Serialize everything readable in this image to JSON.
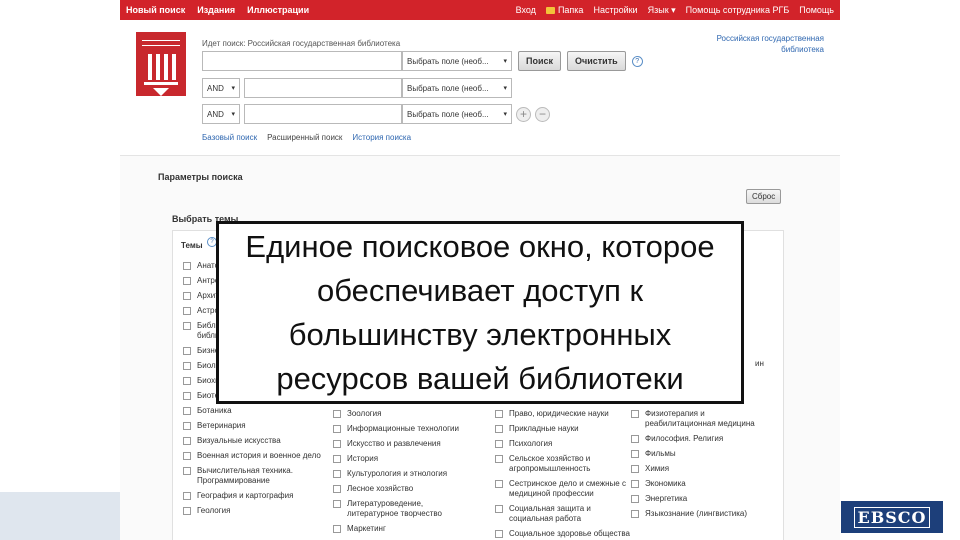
{
  "topbar": {
    "left": [
      "Новый поиск",
      "Издания",
      "Иллюстрации"
    ],
    "right": [
      "Вход",
      "Папка",
      "Настройки",
      "Язык ▾",
      "Помощь сотрудника РГБ",
      "Помощь"
    ]
  },
  "header": {
    "searching_label": "Идет поиск: Российская государственная библиотека",
    "field_placeholder": "Выбрать поле (необ...",
    "field_placeholder_2": "Выбрать поле (необ...",
    "field_placeholder_3": "Выбрать поле (необ...",
    "operator_1": "AND",
    "operator_2": "AND",
    "search_button": "Поиск",
    "clear_button": "Очистить",
    "help": "?",
    "add": "+",
    "remove": "−",
    "library_name": "Российская государственная библиотека",
    "links": [
      "Базовый поиск",
      "Расширенный поиск",
      "История поиска"
    ]
  },
  "params": {
    "title": "Параметры поиска",
    "reset_button": "Сброс",
    "select_topics": "Выбрать темы",
    "topics_label": "Темы",
    "help": "?",
    "col1": [
      "Анатомия",
      "Антропология",
      "Архитектура",
      "Астрономия",
      "Библиотечное дело, библиография",
      "Бизнес",
      "Биология",
      "Биохимия",
      "Биотехнология",
      "Ботаника",
      "Ветеринария",
      "Визуальные искусства",
      "Военная история и военное дело",
      "Вычислительная техника. Программирование",
      "География и картография",
      "Геология"
    ],
    "col2": [
      "Зоология",
      "Информационные технологии",
      "Искусство и развлечения",
      "История",
      "Культурология и этнология",
      "Лесное хозяйство",
      "Литературоведение, литературное творчество",
      "Маркетинг"
    ],
    "col3": [
      "Право, юридические науки",
      "Прикладные науки",
      "Психология",
      "Сельское хозяйство и агропромышленность",
      "Сестринское дело и смежные с медициной профессии",
      "Социальная защита и социальная работа",
      "Социальное здоровье общества"
    ],
    "col4": [
      "Физиотерапия и реабилитационная медицина",
      "Философия. Религия",
      "Фильмы",
      "Химия",
      "Экономика",
      "Энергетика",
      "Языкознание (лингвистика)"
    ],
    "col4_fragment": "ин"
  },
  "overlay": {
    "text": "Единое поисковое окно, которое обеспечивает доступ к большинству электронных ресурсов вашей библиотеки"
  },
  "brand": {
    "ebsco": "EBSCO"
  },
  "colors": {
    "ebsco_red": "#d2232a",
    "ebsco_blue": "#1d3f7a",
    "link_blue": "#2f67b0"
  }
}
